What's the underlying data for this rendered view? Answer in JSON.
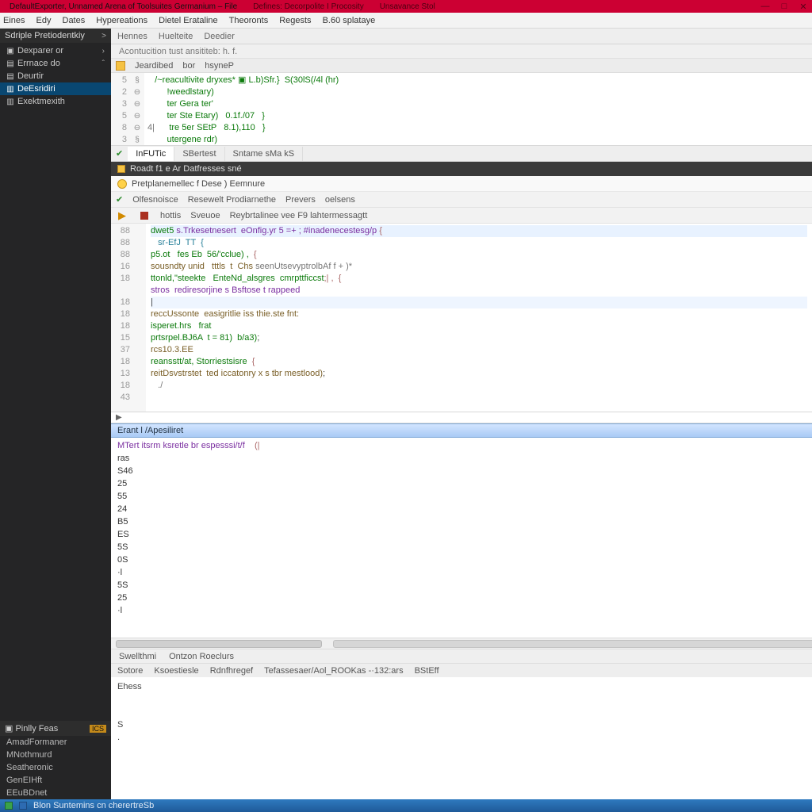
{
  "titlebar": {
    "tabs": [
      "DefaultExporter, Unnamed Arena of Toolsuites Germanium – File",
      "Defines: Decorpolite I Procosity",
      "Unsavance Stol"
    ],
    "min": "—",
    "max": "□",
    "close": "✕"
  },
  "menu": [
    "Eines",
    "Edy",
    "Dates",
    "Hypereations",
    "Dietel Erataline",
    "Theoronts",
    "Regests",
    "B.60 splataye"
  ],
  "sidebar": {
    "section": "Sdriple Pretiodentkiy",
    "arrow": ">",
    "items": [
      {
        "icon": "▣",
        "label": "Dexparer or"
      },
      {
        "icon": "▤",
        "label": "Errnace do"
      },
      {
        "icon": "▤",
        "label": "Deurtir"
      },
      {
        "icon": "▥",
        "label": "DeEsridiri"
      },
      {
        "icon": "▥",
        "label": "Exektmexith"
      }
    ],
    "panel2_title": "Pinlly Feas",
    "panel2_icon": "▣",
    "panel2_items": [
      "AmadFormaner",
      "MNothmurd",
      "Seatheronic",
      "GenEIHft",
      "EEuBDnet"
    ]
  },
  "doctabs": [
    "Hennes",
    "Huelteite",
    "Deedier"
  ],
  "path": "Acontucition tust ansititeb: h. f.",
  "toolbar1": {
    "labels": [
      "Jeardibed",
      "bor",
      "hsyneP"
    ]
  },
  "editor_top": {
    "gutter": [
      "5",
      "2",
      "3",
      "5",
      "8",
      "3"
    ],
    "fold": [
      "§",
      "⊖",
      "⊖",
      "⊖",
      "⊖",
      "§"
    ],
    "lines": [
      {
        "pre": "   ",
        "code": "/~reacultivite dryxes* ▣ L.b)Sfr.}  S(30lS(/4l (hr)"
      },
      {
        "pre": "        ",
        "code": "!weedlstary)"
      },
      {
        "pre": "        ",
        "code": "ter Gera ter'"
      },
      {
        "pre": "        ",
        "code": "ter Ste Etary)   0.1f./07   }"
      },
      {
        "pre": "4|      ",
        "code": "tre 5er SEtP   8.1),110   }"
      },
      {
        "pre": "        ",
        "code": "utergene rdr)"
      }
    ]
  },
  "midtabs": [
    "InFUTic",
    "SBertest",
    "Sntame sMa kS"
  ],
  "darkstrip": "Roadt f1 e Ar Datfresses sné",
  "section_header": "Pretplanemellec f Dese ) Eemnure",
  "subtool1": [
    "Olfesnoisce",
    "Resewelt Prodiarnethe",
    "Prevers",
    "oelsens"
  ],
  "subtool2": [
    "hottis",
    "Sveuoe",
    "Reybrtalinee vee F9 lahtermessagtt"
  ],
  "editor_main": {
    "gutter": [
      "88",
      "88",
      "88",
      "16",
      "18",
      "",
      "18",
      "18",
      "18",
      "15",
      "37",
      "18",
      "13",
      "18",
      "43"
    ],
    "code": [
      [
        {
          "t": "dwet5 ",
          "c": "kw"
        },
        {
          "t": "s.Trkesetnesert  eOnfig.yr 5 =+ ; #inadenecestesg/p",
          "c": "pur"
        },
        {
          "t": " {",
          "c": "br"
        }
      ],
      [
        {
          "t": "   sr-EfJ  TT  {",
          "c": "kw2"
        }
      ],
      [
        {
          "t": "p5.ot   fes Eb  56/'cclue) ,",
          "c": "kw"
        },
        {
          "t": "  {",
          "c": "br"
        }
      ],
      [
        {
          "t": "sousndty unid   tttls  t  Chs ",
          "c": "fn"
        },
        {
          "t": "seenUtsevyptrolbAf f + )*",
          "c": "cmt"
        }
      ],
      [
        {
          "t": "ttonld,\"steekte   EnteNd_alsgres  cmrpttficcst",
          "c": "kw"
        },
        {
          "t": ";| ,  {",
          "c": "br"
        }
      ],
      [
        {
          "t": "stros  rediresorjine s Bsftose t rappeed",
          "c": "pur"
        }
      ],
      [
        {
          "t": "|",
          "c": "op"
        }
      ],
      [
        {
          "t": "reccUssonte  easigritlie iss thie.ste fnt:",
          "c": "fn"
        }
      ],
      [
        {
          "t": "isperet.hrs   frat",
          "c": "kw"
        }
      ],
      [
        {
          "t": "prtsrpel.BJ6A  t = 81)  b/a3)",
          "c": "kw"
        },
        {
          "t": ";",
          "c": "op"
        }
      ],
      [
        {
          "t": "rcs10.3.EE",
          "c": "fn"
        }
      ],
      [
        {
          "t": "reansstt/at, Storriestsisre  ",
          "c": "kw"
        },
        {
          "t": "{",
          "c": "br"
        }
      ],
      [
        {
          "t": "reitDsvstrstet  ted iccatonry x s tbr mestlood)",
          "c": "fn"
        },
        {
          "t": ";",
          "c": "op"
        }
      ],
      [
        {
          "t": "   ./",
          "c": "cmt"
        }
      ],
      [
        {
          "t": "",
          "c": ""
        }
      ]
    ]
  },
  "scroll_tri": "▶",
  "out_head": "Erant l /Apesiliret",
  "out": {
    "first": {
      "pre": "MTert itsrm ksretle br espesssi/t/f    ",
      "br": "(|"
    },
    "label": "ras",
    "values": [
      "S46",
      "25",
      "55",
      "24",
      "B5",
      "ES",
      "5S",
      "0S",
      "·l",
      "5S",
      "25",
      "·l"
    ]
  },
  "btabs": [
    "Swellthmi",
    "Ontzon Roeclurs"
  ],
  "consolebar": [
    "Sotore",
    "Ksoestiesle",
    "Rdnfhregef",
    "Tefassesaer/Aol_ROOKas -·132:ars",
    "BStEff"
  ],
  "console": [
    "Ehess",
    "",
    "",
    "S",
    "."
  ],
  "status": "Blon Suntemins cn cherertreSb"
}
